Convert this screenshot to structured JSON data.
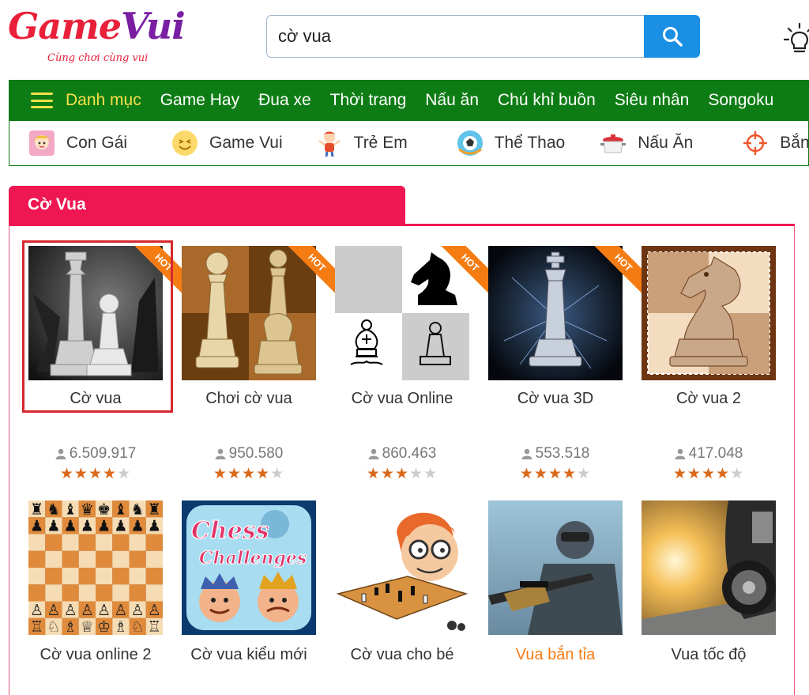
{
  "header": {
    "logo_text_a": "Game",
    "logo_text_b": "Vui",
    "logo_tagline": "Cùng chơi cùng vui",
    "search": {
      "value": "cờ vua"
    }
  },
  "menu": {
    "category_label": "Danh mục",
    "items": [
      "Game Hay",
      "Đua xe",
      "Thời trang",
      "Nấu ăn",
      "Chú khỉ buồn",
      "Siêu nhân",
      "Songoku"
    ]
  },
  "catbar": {
    "items": [
      {
        "label": "Con Gái",
        "icon": "girl-icon"
      },
      {
        "label": "Game Vui",
        "icon": "smiley-icon"
      },
      {
        "label": "Trẻ Em",
        "icon": "child-icon"
      },
      {
        "label": "Thể Thao",
        "icon": "ball-icon"
      },
      {
        "label": "Nấu Ăn",
        "icon": "pot-icon"
      },
      {
        "label": "Bắn",
        "icon": "crosshair-icon"
      }
    ]
  },
  "section": {
    "title": "Cờ Vua"
  },
  "games_row1": [
    {
      "title": "Cờ vua",
      "plays": "6.509.917",
      "rating": 4,
      "hot": "HOT"
    },
    {
      "title": "Chơi cờ vua",
      "plays": "950.580",
      "rating": 4,
      "hot": "HOT"
    },
    {
      "title": "Cờ vua Online",
      "plays": "860.463",
      "rating": 3,
      "hot": "HOT"
    },
    {
      "title": "Cờ vua 3D",
      "plays": "553.518",
      "rating": 4,
      "hot": "HOT"
    },
    {
      "title": "Cờ vua 2",
      "plays": "417.048",
      "rating": 4
    }
  ],
  "games_row2": [
    {
      "title": "Cờ vua online 2"
    },
    {
      "title": "Cờ vua kiểu mới",
      "thumb_text_a": "Chess",
      "thumb_text_b": "Challenges"
    },
    {
      "title": "Cờ vua cho bé"
    },
    {
      "title": "Vua bắn tỉa"
    },
    {
      "title": "Vua tốc độ"
    }
  ],
  "colors": {
    "menu_green": "#0e7c14",
    "menu_highlight": "#f5e04a",
    "section_pink": "#ee1752",
    "search_blue": "#1a8fe3",
    "star_on": "#d9691a",
    "hot_orange": "#f57c13",
    "selected_border": "#d7282f"
  }
}
